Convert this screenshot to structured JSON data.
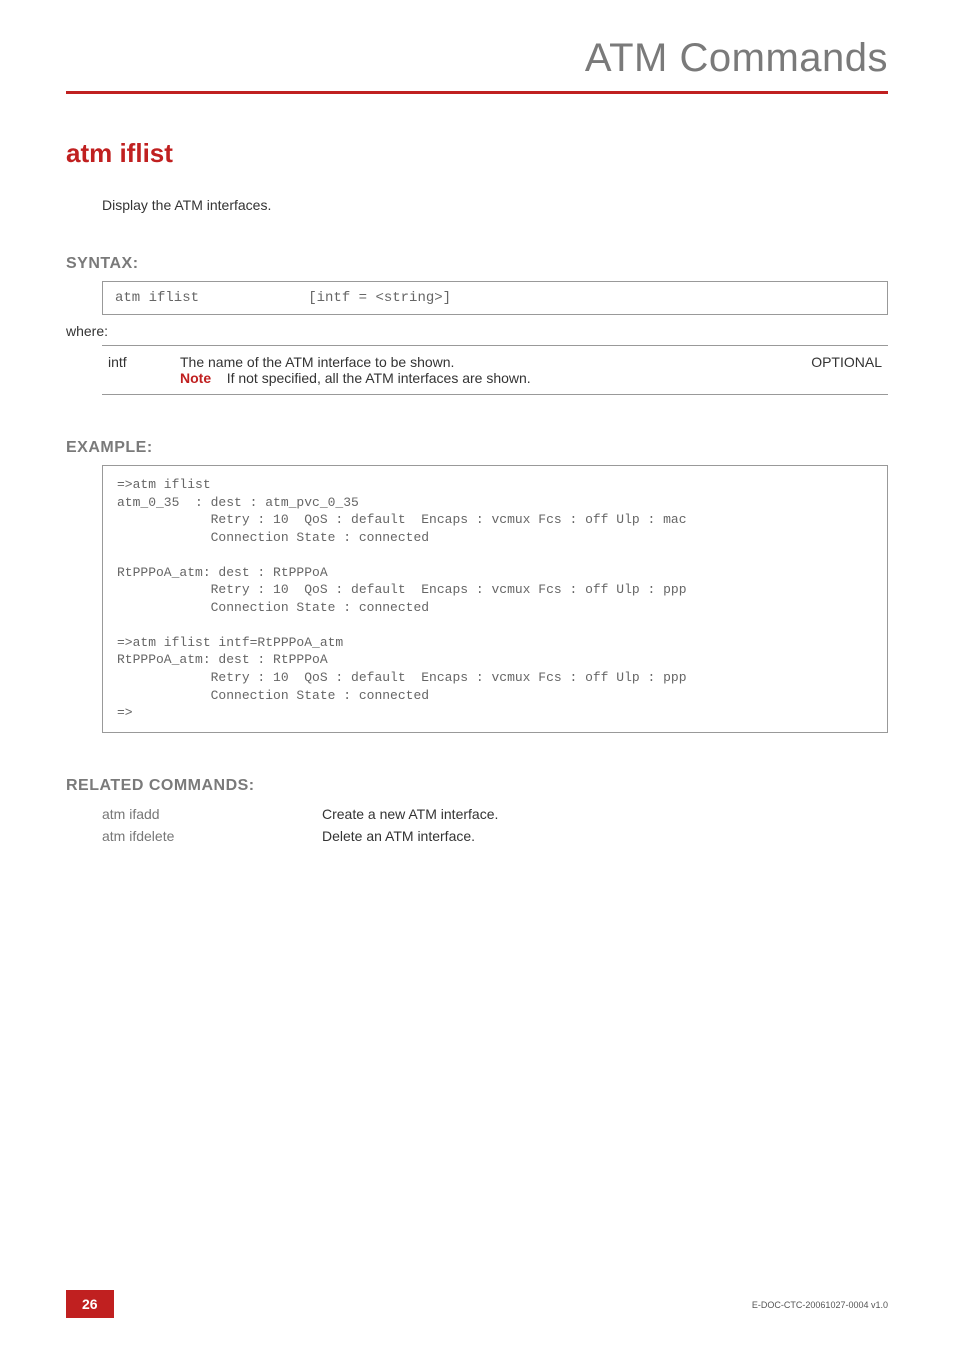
{
  "header": {
    "title": "ATM Commands"
  },
  "command": {
    "name": "atm iflist",
    "intro": "Display the ATM interfaces."
  },
  "syntax": {
    "label": "SYNTAX:",
    "line": "atm iflist             [intf = <string>]",
    "whereLabel": "where:",
    "params": [
      {
        "name": "intf",
        "desc_line1": "The name of the ATM interface to be shown.",
        "note_label": "Note",
        "note_text": "If not specified, all the ATM interfaces are shown.",
        "optional": "OPTIONAL"
      }
    ]
  },
  "example": {
    "label": "EXAMPLE:",
    "text": "=>atm iflist\natm_0_35  : dest : atm_pvc_0_35\n            Retry : 10  QoS : default  Encaps : vcmux Fcs : off Ulp : mac\n            Connection State : connected\n\nRtPPPoA_atm: dest : RtPPPoA\n            Retry : 10  QoS : default  Encaps : vcmux Fcs : off Ulp : ppp\n            Connection State : connected\n\n=>atm iflist intf=RtPPPoA_atm\nRtPPPoA_atm: dest : RtPPPoA\n            Retry : 10  QoS : default  Encaps : vcmux Fcs : off Ulp : ppp\n            Connection State : connected\n=>"
  },
  "related": {
    "label": "RELATED COMMANDS:",
    "items": [
      {
        "cmd": "atm ifadd",
        "desc": "Create a new ATM interface."
      },
      {
        "cmd": "atm ifdelete",
        "desc": "Delete an ATM interface."
      }
    ]
  },
  "footer": {
    "pageNumber": "26",
    "docId": "E-DOC-CTC-20061027-0004 v1.0"
  }
}
